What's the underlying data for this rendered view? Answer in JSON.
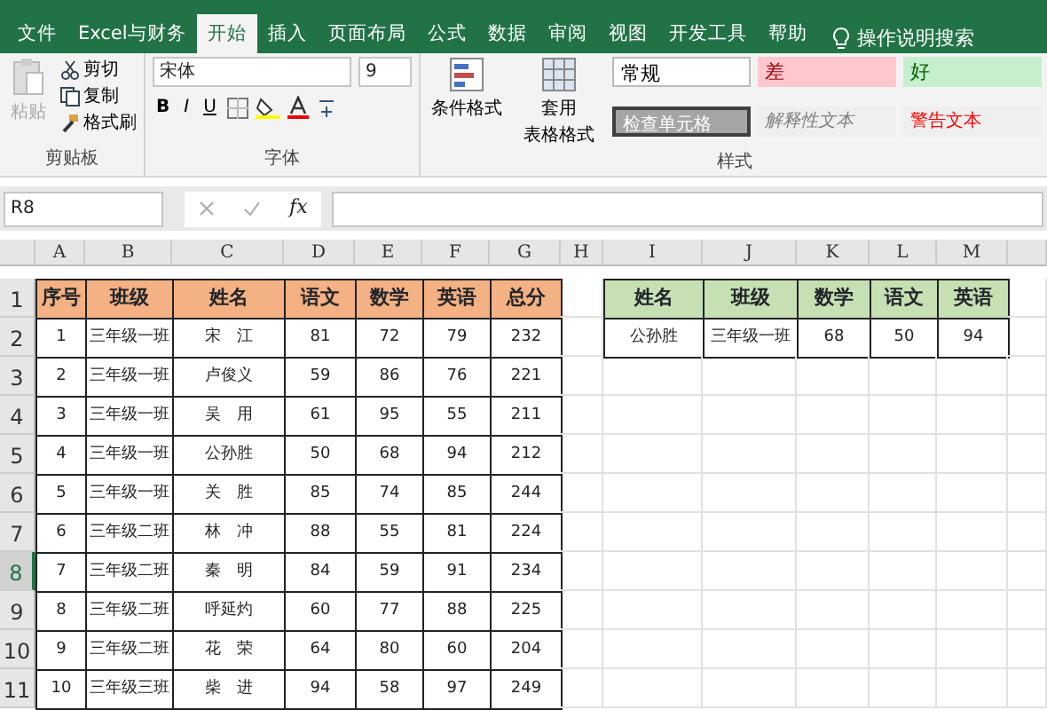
{
  "tabs": [
    {
      "label": "文件",
      "selected": false
    },
    {
      "label": "Excel与财务",
      "selected": false
    },
    {
      "label": "开始",
      "selected": true
    },
    {
      "label": "插入",
      "selected": false
    },
    {
      "label": "页面布局",
      "selected": false
    },
    {
      "label": "公式",
      "selected": false
    },
    {
      "label": "数据",
      "selected": false
    },
    {
      "label": "审阅",
      "selected": false
    },
    {
      "label": "视图",
      "selected": false
    },
    {
      "label": "开发工具",
      "selected": false
    },
    {
      "label": "帮助",
      "selected": false
    }
  ],
  "tell_me": "操作说明搜索",
  "clipboard": {
    "paste": "粘贴",
    "cut": "剪切",
    "copy": "复制",
    "format_painter": "格式刷",
    "group": "剪贴板"
  },
  "font": {
    "name": "宋体",
    "size": "9",
    "bold": "B",
    "italic": "I",
    "underline": "U",
    "group": "字体"
  },
  "styles": {
    "conditional": "条件格式",
    "table_format": [
      "套用",
      "表格格式"
    ],
    "cells": [
      {
        "label": "常规",
        "kind": "normal"
      },
      {
        "label": "差",
        "kind": "bad"
      },
      {
        "label": "好",
        "kind": "good"
      },
      {
        "label": "检查单元格",
        "kind": "check"
      },
      {
        "label": "解释性文本",
        "kind": "explanatory"
      },
      {
        "label": "警告文本",
        "kind": "warning"
      }
    ],
    "group": "样式"
  },
  "formula_bar": {
    "name_box": "R8",
    "fx": "fx"
  },
  "columns": [
    {
      "label": "A",
      "selected": false
    },
    {
      "label": "B",
      "selected": false
    },
    {
      "label": "C",
      "selected": false
    },
    {
      "label": "D",
      "selected": false
    },
    {
      "label": "E",
      "selected": false
    },
    {
      "label": "F",
      "selected": false
    },
    {
      "label": "G",
      "selected": false
    },
    {
      "label": "H",
      "selected": false
    },
    {
      "label": "I",
      "selected": false
    },
    {
      "label": "J",
      "selected": false
    },
    {
      "label": "K",
      "selected": false
    },
    {
      "label": "L",
      "selected": false
    },
    {
      "label": "M",
      "selected": false
    }
  ],
  "row_headers": [
    {
      "label": "1",
      "selected": false
    },
    {
      "label": "2",
      "selected": false
    },
    {
      "label": "3",
      "selected": false
    },
    {
      "label": "4",
      "selected": false
    },
    {
      "label": "5",
      "selected": false
    },
    {
      "label": "6",
      "selected": false
    },
    {
      "label": "7",
      "selected": false
    },
    {
      "label": "8",
      "selected": true
    },
    {
      "label": "9",
      "selected": false
    },
    {
      "label": "10",
      "selected": false
    },
    {
      "label": "11",
      "selected": false
    }
  ],
  "score_table": {
    "columns": [
      "序号",
      "班级",
      "姓名",
      "语文",
      "数学",
      "英语",
      "总分"
    ],
    "rows": [
      [
        "1",
        "三年级一班",
        "宋　江",
        "81",
        "72",
        "79",
        "232"
      ],
      [
        "2",
        "三年级一班",
        "卢俊义",
        "59",
        "86",
        "76",
        "221"
      ],
      [
        "3",
        "三年级一班",
        "吴　用",
        "61",
        "95",
        "55",
        "211"
      ],
      [
        "4",
        "三年级一班",
        "公孙胜",
        "50",
        "68",
        "94",
        "212"
      ],
      [
        "5",
        "三年级一班",
        "关　胜",
        "85",
        "74",
        "85",
        "244"
      ],
      [
        "6",
        "三年级二班",
        "林　冲",
        "88",
        "55",
        "81",
        "224"
      ],
      [
        "7",
        "三年级二班",
        "秦　明",
        "84",
        "59",
        "91",
        "234"
      ],
      [
        "8",
        "三年级二班",
        "呼延灼",
        "60",
        "77",
        "88",
        "225"
      ],
      [
        "9",
        "三年级二班",
        "花　荣",
        "64",
        "80",
        "60",
        "204"
      ],
      [
        "10",
        "三年级三班",
        "柴　进",
        "94",
        "58",
        "97",
        "249"
      ]
    ]
  },
  "lookup_table": {
    "columns": [
      "姓名",
      "班级",
      "数学",
      "语文",
      "英语"
    ],
    "rows": [
      [
        "公孙胜",
        "三年级一班",
        "68",
        "50",
        "94"
      ]
    ]
  }
}
